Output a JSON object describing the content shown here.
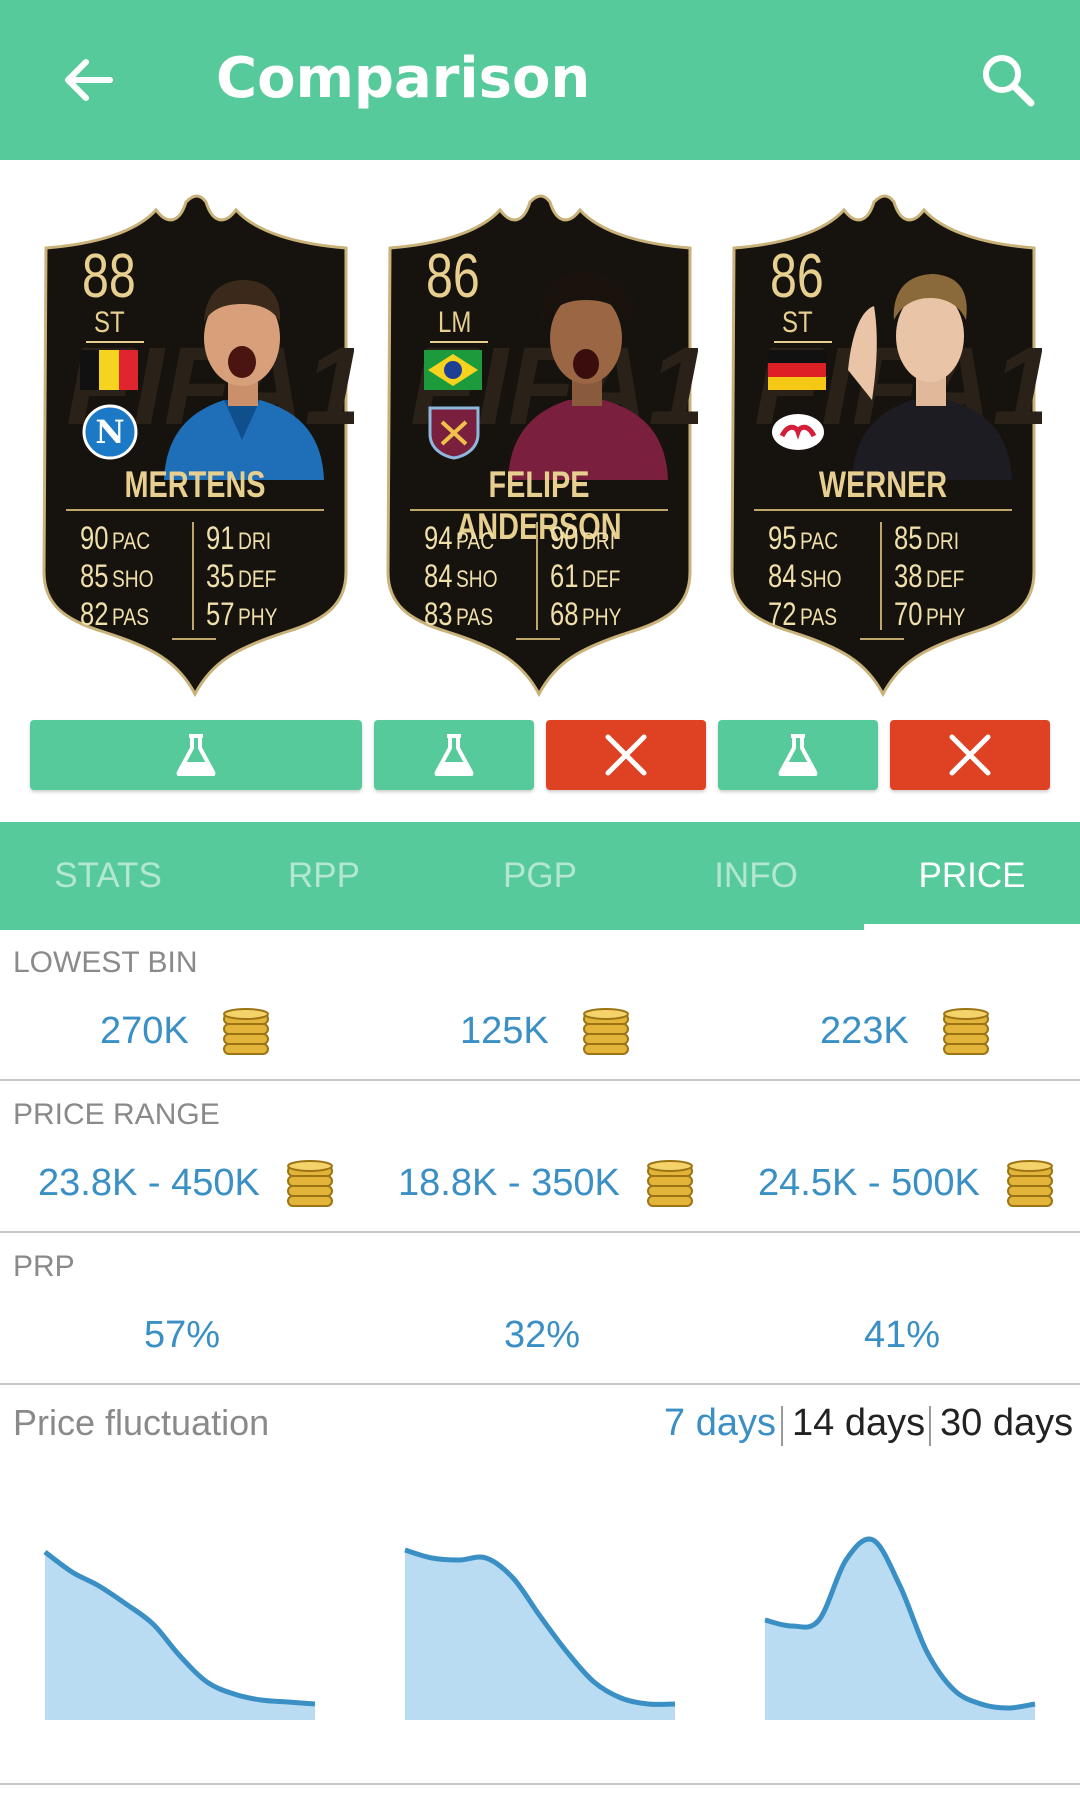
{
  "app_bar": {
    "title": "Comparison",
    "back_icon": "arrow-left-icon",
    "search_icon": "search-icon"
  },
  "colors": {
    "primary": "#57ca9c",
    "remove": "#de4223",
    "value_text": "#3a8fc4",
    "card_gold": "#e7cf8f",
    "card_bg": "#16120d"
  },
  "cards": [
    {
      "rating": "88",
      "position": "ST",
      "name": "MERTENS",
      "nation_flag": "belgium-flag",
      "club_badge": "napoli-badge",
      "stats": [
        {
          "v": "90",
          "l": "PAC"
        },
        {
          "v": "85",
          "l": "SHO"
        },
        {
          "v": "82",
          "l": "PAS"
        },
        {
          "v": "91",
          "l": "DRI"
        },
        {
          "v": "35",
          "l": "DEF"
        },
        {
          "v": "57",
          "l": "PHY"
        }
      ]
    },
    {
      "rating": "86",
      "position": "LM",
      "name": "FELIPE ANDERSON",
      "nation_flag": "brazil-flag",
      "club_badge": "west-ham-badge",
      "stats": [
        {
          "v": "94",
          "l": "PAC"
        },
        {
          "v": "84",
          "l": "SHO"
        },
        {
          "v": "83",
          "l": "PAS"
        },
        {
          "v": "90",
          "l": "DRI"
        },
        {
          "v": "61",
          "l": "DEF"
        },
        {
          "v": "68",
          "l": "PHY"
        }
      ]
    },
    {
      "rating": "86",
      "position": "ST",
      "name": "WERNER",
      "nation_flag": "germany-flag",
      "club_badge": "rb-leipzig-badge",
      "stats": [
        {
          "v": "95",
          "l": "PAC"
        },
        {
          "v": "84",
          "l": "SHO"
        },
        {
          "v": "72",
          "l": "PAS"
        },
        {
          "v": "85",
          "l": "DRI"
        },
        {
          "v": "38",
          "l": "DEF"
        },
        {
          "v": "70",
          "l": "PHY"
        }
      ]
    }
  ],
  "actions": [
    "flask-icon",
    "flask-icon",
    "close-icon",
    "flask-icon",
    "close-icon"
  ],
  "tabs": [
    {
      "label": "STATS",
      "active": false
    },
    {
      "label": "RPP",
      "active": false
    },
    {
      "label": "PGP",
      "active": false
    },
    {
      "label": "INFO",
      "active": false
    },
    {
      "label": "PRICE",
      "active": true
    }
  ],
  "lowest_bin": {
    "label": "LOWEST BIN",
    "values": [
      "270K",
      "125K",
      "223K"
    ]
  },
  "price_range": {
    "label": "PRICE RANGE",
    "values": [
      "23.8K - 450K",
      "18.8K - 350K",
      "24.5K - 500K"
    ]
  },
  "prp": {
    "label": "PRP",
    "values": [
      "57%",
      "32%",
      "41%"
    ]
  },
  "fluctuation": {
    "label": "Price fluctuation",
    "ranges": [
      {
        "label": "7 days",
        "active": true
      },
      {
        "label": "14 days",
        "active": false
      },
      {
        "label": "30 days",
        "active": false
      }
    ],
    "series_shape": [
      [
        0.84,
        0.74,
        0.67,
        0.58,
        0.48,
        0.32,
        0.19,
        0.13,
        0.1,
        0.09,
        0.08
      ],
      [
        0.85,
        0.81,
        0.8,
        0.81,
        0.71,
        0.52,
        0.34,
        0.19,
        0.11,
        0.08,
        0.08
      ],
      [
        0.5,
        0.47,
        0.5,
        0.8,
        0.9,
        0.67,
        0.34,
        0.15,
        0.08,
        0.06,
        0.08
      ]
    ]
  }
}
